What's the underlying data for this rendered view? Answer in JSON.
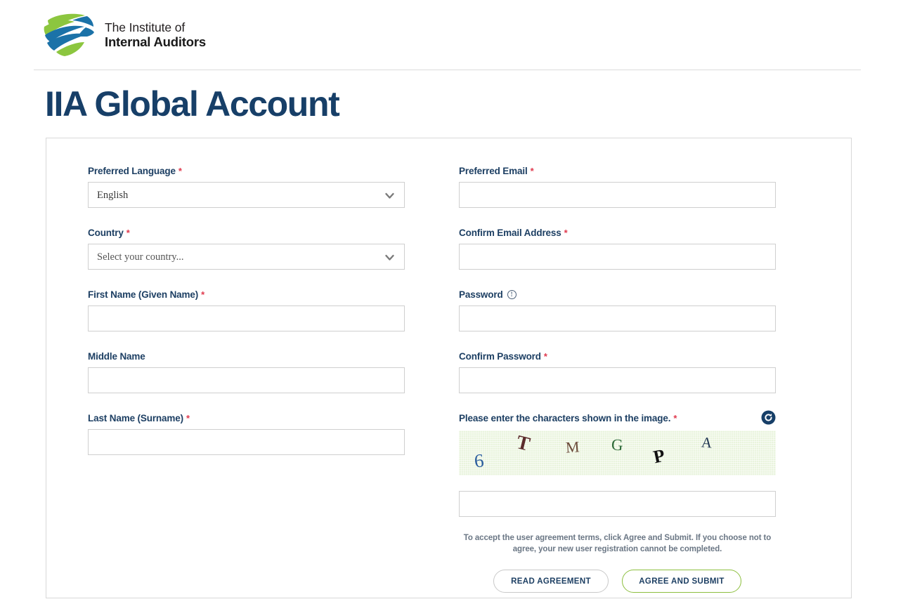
{
  "header": {
    "logo_icon": "iia-globe-logo",
    "logo_line1": "The Institute of",
    "logo_line2": "Internal Auditors"
  },
  "page_title": "IIA Global Account",
  "form": {
    "left_column": [
      {
        "label": "Preferred Language",
        "required": true,
        "type": "select",
        "value": "English"
      },
      {
        "label": "Country",
        "required": true,
        "type": "select",
        "value": "Select your country..."
      },
      {
        "label": "First Name (Given Name)",
        "required": true,
        "type": "text",
        "value": ""
      },
      {
        "label": "Middle Name",
        "required": false,
        "type": "text",
        "value": ""
      },
      {
        "label": "Last Name (Surname)",
        "required": true,
        "type": "text",
        "value": ""
      }
    ],
    "right_column": [
      {
        "label": "Preferred Email",
        "required": true,
        "type": "text",
        "value": ""
      },
      {
        "label": "Confirm Email Address",
        "required": true,
        "type": "text",
        "value": ""
      },
      {
        "label": "Password",
        "required": false,
        "info_icon": "info-circle-icon",
        "type": "password",
        "value": ""
      },
      {
        "label": "Confirm Password",
        "required": true,
        "type": "password",
        "value": ""
      }
    ],
    "captcha": {
      "label": "Please enter the characters shown in the image.",
      "required": true,
      "refresh_icon": "refresh-captcha-icon",
      "characters": [
        "6",
        "T",
        "M",
        "G",
        "P",
        "A"
      ],
      "input_value": "",
      "background_color": "#e9f4dd"
    },
    "agreement_text": "To accept the user agreement terms, click Agree and Submit. If you choose not to agree, your new user registration cannot be completed.",
    "buttons": {
      "read_agreement": "READ AGREEMENT",
      "agree_and_submit": "AGREE AND SUBMIT"
    }
  },
  "colors": {
    "title_navy": "#173f68",
    "label_navy": "#1d3f63",
    "required_red": "#e03a4e",
    "brand_green": "#8dbf3f",
    "brand_blue": "#1b72a8",
    "captcha_bg": "#e9f4dd"
  }
}
